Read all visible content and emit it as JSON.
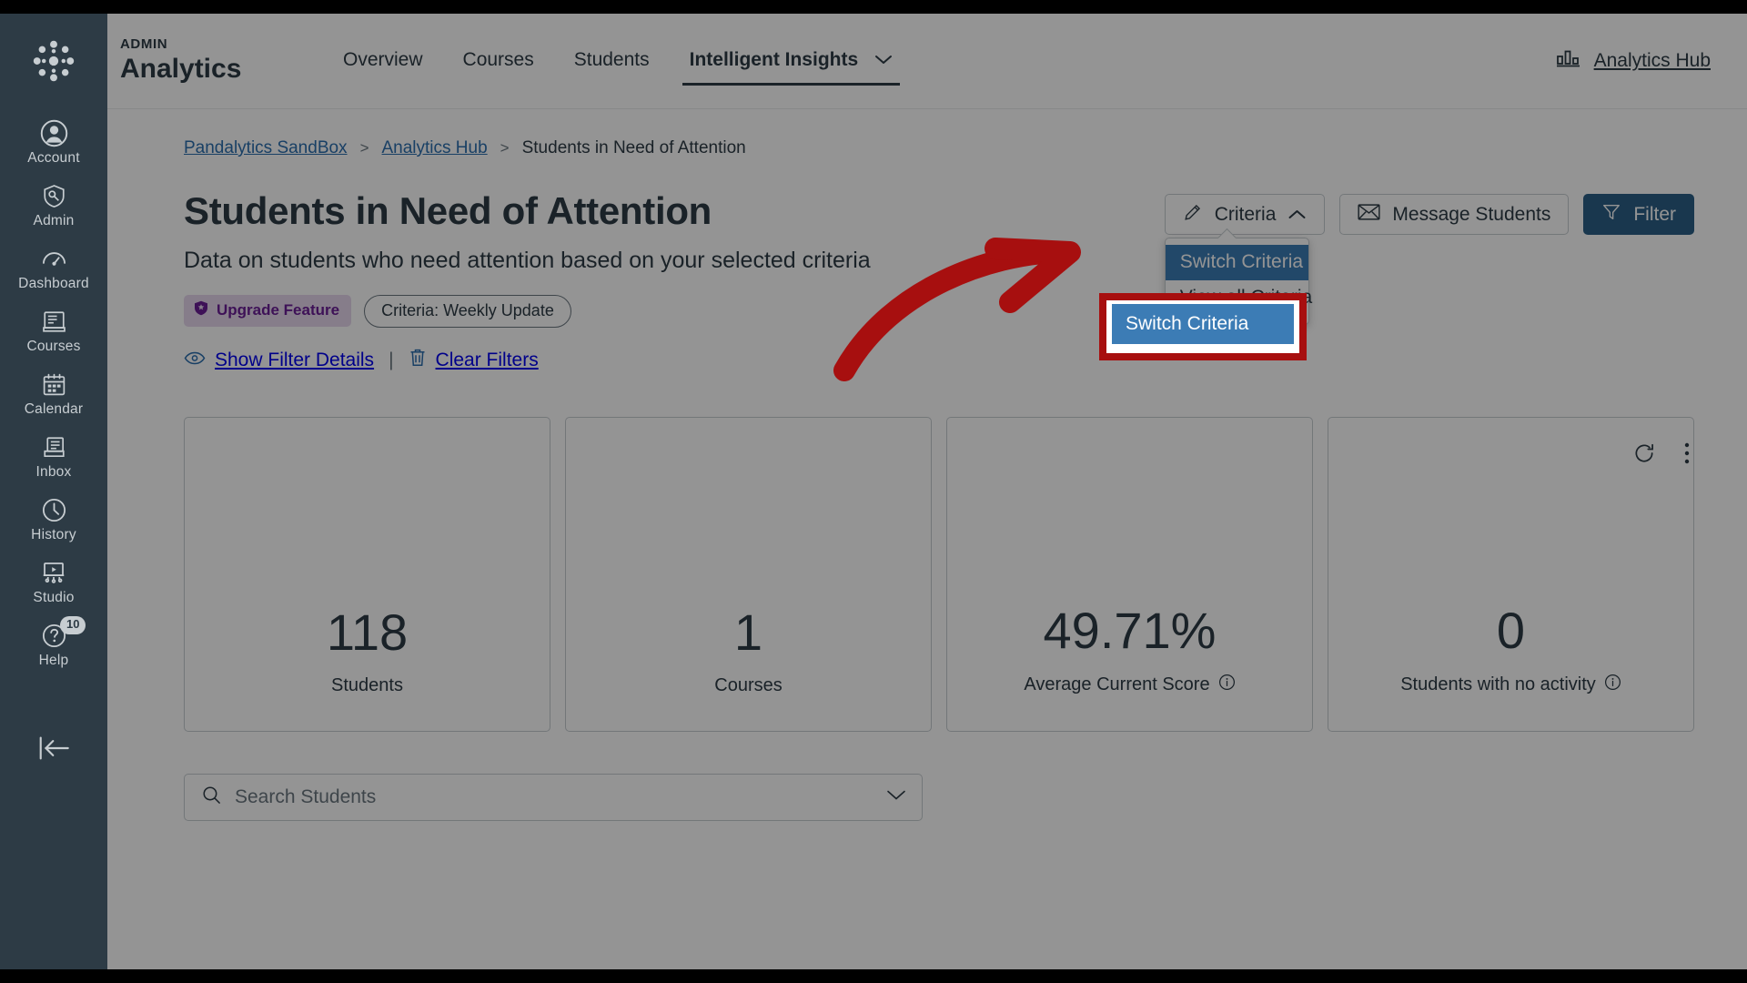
{
  "global_nav": {
    "logo": "canvas-logo",
    "items": [
      {
        "label": "Account",
        "icon": "account-icon"
      },
      {
        "label": "Admin",
        "icon": "admin-shield-icon"
      },
      {
        "label": "Dashboard",
        "icon": "dashboard-gauge-icon"
      },
      {
        "label": "Courses",
        "icon": "courses-book-icon"
      },
      {
        "label": "Calendar",
        "icon": "calendar-icon"
      },
      {
        "label": "Inbox",
        "icon": "inbox-tray-icon"
      },
      {
        "label": "History",
        "icon": "history-clock-icon"
      },
      {
        "label": "Studio",
        "icon": "studio-screen-icon"
      },
      {
        "label": "Help",
        "icon": "help-question-icon",
        "badge": "10"
      }
    ],
    "collapse_icon": "collapse-arrow-icon"
  },
  "app_header": {
    "kicker": "ADMIN",
    "product": "Analytics",
    "nav": [
      {
        "label": "Overview",
        "active": false,
        "caret": false
      },
      {
        "label": "Courses",
        "active": false,
        "caret": false
      },
      {
        "label": "Students",
        "active": false,
        "caret": false
      },
      {
        "label": "Intelligent Insights",
        "active": true,
        "caret": true
      }
    ],
    "hub_link": "Analytics Hub",
    "hub_icon": "bar-chart-icon"
  },
  "breadcrumb": {
    "items": [
      "Pandalytics SandBox",
      "Analytics Hub",
      "Students in Need of Attention"
    ],
    "separator": ">"
  },
  "page": {
    "title": "Students in Need of Attention",
    "subtitle": "Data on students who need attention based on your selected criteria",
    "upgrade_badge": "Upgrade Feature",
    "criteria_pill": "Criteria: Weekly Update",
    "show_filter_details": "Show Filter Details",
    "clear_filters": "Clear Filters",
    "link_divider": "|"
  },
  "actions": {
    "criteria_button": "Criteria",
    "criteria_icon": "pencil-icon",
    "criteria_caret": "chevron-up-icon",
    "message_students": "Message Students",
    "message_icon": "envelope-icon",
    "filter_button": "Filter",
    "filter_icon": "funnel-icon",
    "menu": {
      "switch_criteria": "Switch Criteria",
      "view_all_criteria": "View all Criteria"
    }
  },
  "table_tools": {
    "refresh_icon": "refresh-icon",
    "more_icon": "kebab-menu-icon"
  },
  "stat_cards": [
    {
      "value": "118",
      "caption": "Students",
      "info": false
    },
    {
      "value": "1",
      "caption": "Courses",
      "info": false
    },
    {
      "value": "49.71%",
      "caption": "Average Current Score",
      "info": true
    },
    {
      "value": "0",
      "caption": "Students with no activity",
      "info": true
    }
  ],
  "search": {
    "placeholder": "Search Students",
    "value": "",
    "icon": "search-icon",
    "caret_icon": "chevron-down-icon"
  },
  "annotation": {
    "arrow_color": "#A70F0F",
    "highlight_color": "#A70F0F",
    "highlighted_item": "Switch Criteria"
  },
  "colors": {
    "nav_bg": "#2D3B45",
    "link": "#2B6EAF",
    "primary_button": "#2B5F87",
    "menu_highlight": "#3C7CB5",
    "upgrade_badge_bg": "#E7D8EE",
    "upgrade_badge_fg": "#6B1E96"
  }
}
